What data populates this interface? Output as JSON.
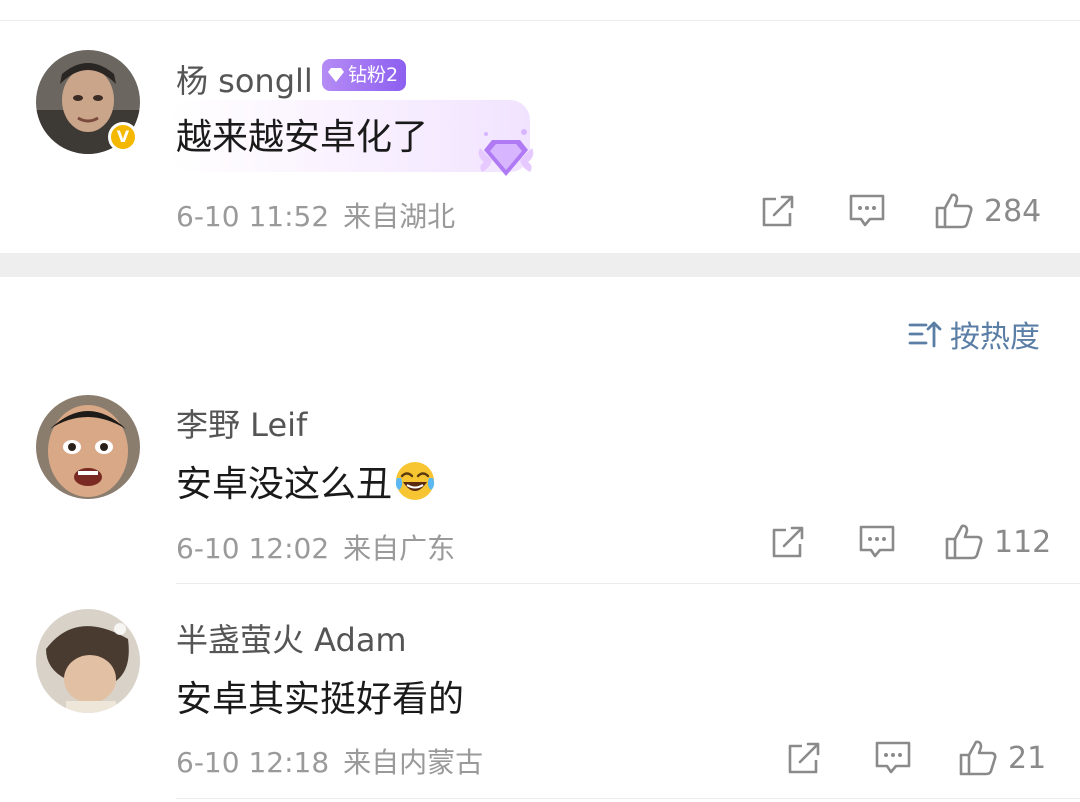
{
  "comments": [
    {
      "user": "杨 songll",
      "badge": "钻粉2",
      "text": "越来越安卓化了",
      "time": "6-10 11:52",
      "location": "来自湖北",
      "likes": "284"
    },
    {
      "user": "李野 Leif",
      "text": "安卓没这么丑",
      "time": "6-10 12:02",
      "location": "来自广东",
      "likes": "112"
    },
    {
      "user": "半盏萤火 Adam",
      "text": "安卓其实挺好看的",
      "time": "6-10 12:18",
      "location": "来自内蒙古",
      "likes": "21"
    }
  ],
  "sort": {
    "label": "按热度"
  },
  "colors": {
    "accent": "#5a7ea6",
    "badge": "#9b6cf2",
    "verified": "#f5b800"
  },
  "icons": {
    "share": "share-icon",
    "reply": "comment-icon",
    "like": "thumbs-up-icon",
    "sort": "sort-icon",
    "emoji": "laugh-cry-emoji-icon"
  }
}
